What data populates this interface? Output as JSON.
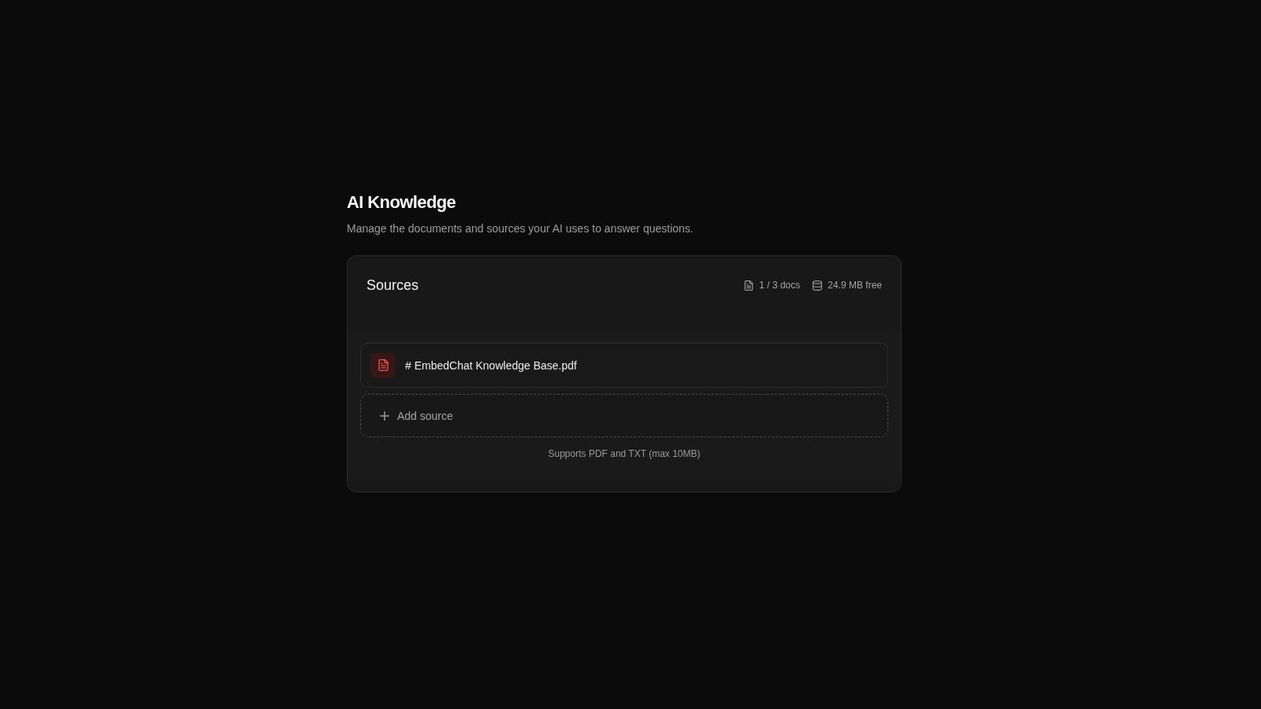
{
  "page": {
    "title": "AI Knowledge",
    "subtitle": "Manage the documents and sources your AI uses to answer questions."
  },
  "sources": {
    "title": "Sources",
    "stats": [
      {
        "kind": "docs",
        "text": "1 / 3 docs"
      },
      {
        "kind": "storage",
        "text": "24.9 MB free"
      }
    ],
    "files": [
      {
        "kind": "pdf",
        "name": "# EmbedChat Knowledge Base.pdf"
      }
    ],
    "add_button": "Add source",
    "hint": "Supports PDF and TXT (max 10MB)"
  }
}
